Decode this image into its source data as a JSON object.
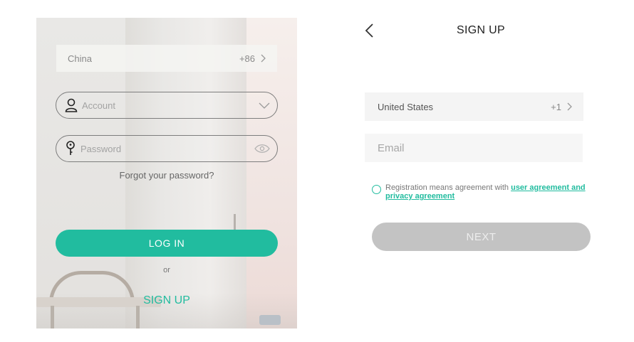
{
  "login": {
    "country_name": "China",
    "country_code": "+86",
    "account_placeholder": "Account",
    "password_placeholder": "Password",
    "forgot_label": "Forgot your password?",
    "login_label": "LOG IN",
    "or_label": "or",
    "signup_label": "SIGN UP"
  },
  "signup": {
    "title": "SIGN UP",
    "country_name": "United States",
    "country_code": "+1",
    "email_placeholder": "Email",
    "agreement_prefix": "Registration means agreement with ",
    "agreement_link": "user agreement and privacy agreement",
    "next_label": "NEXT"
  },
  "colors": {
    "accent": "#21bc9f",
    "disabled_button": "#c3c3c3"
  },
  "icons": {
    "country_chevron": "chevron-right-icon",
    "account": "user-icon",
    "account_dropdown": "chevron-down-icon",
    "password": "key-icon",
    "password_visibility": "eye-icon",
    "back": "chevron-left-icon"
  }
}
